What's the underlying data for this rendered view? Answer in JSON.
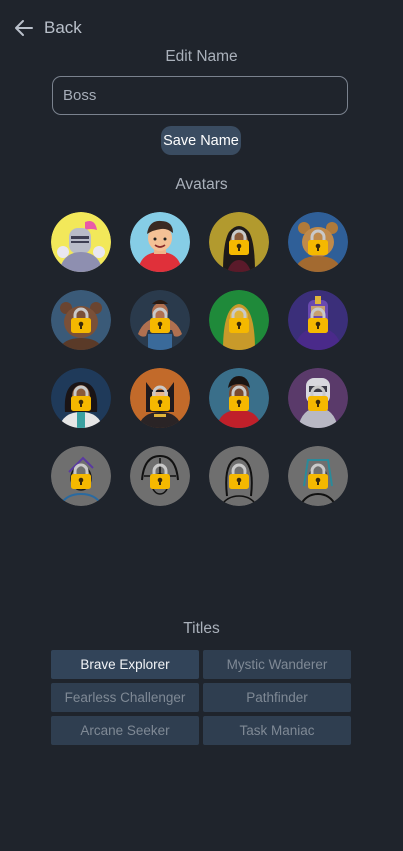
{
  "nav": {
    "back_label": "Back"
  },
  "edit_name": {
    "heading": "Edit Name",
    "input_value": "Boss",
    "save_label": "Save Name"
  },
  "avatars": {
    "heading": "Avatars",
    "items": [
      {
        "name": "knight",
        "bg": "#f2e85a",
        "locked": false
      },
      {
        "name": "red-hoodie-boy",
        "bg": "#86cde6",
        "locked": false
      },
      {
        "name": "dark-haired-woman",
        "bg": "#b29a2e",
        "locked": true
      },
      {
        "name": "bear",
        "bg": "#2f5f98",
        "locked": true
      },
      {
        "name": "brown-bear",
        "bg": "#3a5a78",
        "locked": true
      },
      {
        "name": "muscle-man",
        "bg": "#2a3a4c",
        "locked": true
      },
      {
        "name": "yellow-creature",
        "bg": "#1f8a3a",
        "locked": true
      },
      {
        "name": "purple-warrior",
        "bg": "#3b2f7a",
        "locked": true
      },
      {
        "name": "lab-woman",
        "bg": "#1f3a5a",
        "locked": true
      },
      {
        "name": "ninja",
        "bg": "#c26a2a",
        "locked": true
      },
      {
        "name": "hoodie-man",
        "bg": "#3a6f8a",
        "locked": true
      },
      {
        "name": "helmet-knight",
        "bg": "#5a3a6a",
        "locked": true
      },
      {
        "name": "wizard-outline",
        "bg": "#6f6f6f",
        "locked": true
      },
      {
        "name": "hooded-outline",
        "bg": "#6f6f6f",
        "locked": true
      },
      {
        "name": "long-hair-outline",
        "bg": "#6f6f6f",
        "locked": true
      },
      {
        "name": "pharaoh-outline",
        "bg": "#6f6f6f",
        "locked": true
      }
    ]
  },
  "titles": {
    "heading": "Titles",
    "items": [
      {
        "label": "Brave Explorer",
        "active": true
      },
      {
        "label": "Mystic Wanderer",
        "active": false
      },
      {
        "label": "Fearless Challenger",
        "active": false
      },
      {
        "label": "Pathfinder",
        "active": false
      },
      {
        "label": "Arcane Seeker",
        "active": false
      },
      {
        "label": "Task Maniac",
        "active": false
      }
    ]
  },
  "colors": {
    "background": "#1f242c",
    "accent_button": "#3a4c61",
    "title_button": "#2f3e50",
    "lock_gold": "#f5b800"
  }
}
